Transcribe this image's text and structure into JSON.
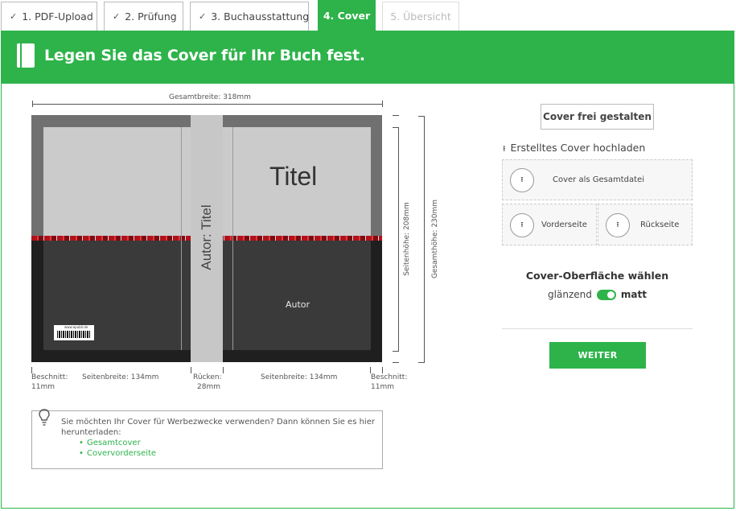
{
  "tabs": [
    {
      "label": "1. PDF-Upload",
      "state": "done"
    },
    {
      "label": "2. Prüfung",
      "state": "done"
    },
    {
      "label": "3. Buchausstattung",
      "state": "done"
    },
    {
      "label": "4. Cover",
      "state": "active"
    },
    {
      "label": "5. Übersicht",
      "state": "disabled"
    }
  ],
  "banner": {
    "title": "Legen Sie das Cover für Ihr Buch fest.",
    "icon": "book-icon"
  },
  "dimensions": {
    "total_width": "Gesamtbreite: 318mm",
    "page_height": "Seitenhöhe: 208mm",
    "total_height": "Gesamthöhe: 230mm",
    "bleed_left": [
      "Beschnitt:",
      "11mm"
    ],
    "page_width_left": "Seitenbreite: 134mm",
    "spine": [
      "Rücken:",
      "28mm"
    ],
    "page_width_right": "Seitenbreite: 134mm",
    "bleed_right": [
      "Beschnitt:",
      "11mm"
    ]
  },
  "cover": {
    "title": "Titel",
    "author": "Autor",
    "spine_text": "Autor: Titel",
    "barcode_text": "www.epubli.de",
    "colors": {
      "bleed": "#707070",
      "page_top": "#cbcbcb",
      "page_bottom": "#3a3a3a",
      "band": "#b1111a"
    }
  },
  "actions": {
    "design_button": "Cover frei gestalten",
    "upload_heading": "Erstelltes Cover hochladen",
    "upload_full": "Cover als Gesamtdatei",
    "upload_front": "Vorderseite",
    "upload_back": "Rückseite"
  },
  "surface": {
    "title": "Cover-Oberfläche wählen",
    "option_left": "glänzend",
    "option_right": "matt",
    "selected": "matt"
  },
  "next_button": "WEITER",
  "info": {
    "text": "Sie möchten Ihr Cover für Werbezwecke verwenden? Dann können Sie es hier herunterladen:",
    "links": [
      "Gesamtcover",
      "Covervorderseite"
    ]
  },
  "accent_color": "#2db34a"
}
